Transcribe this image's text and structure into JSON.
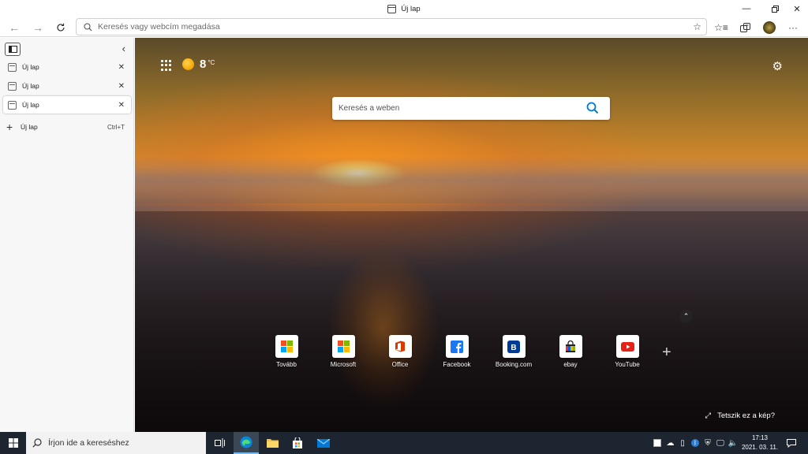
{
  "window": {
    "title": "Új lap"
  },
  "toolbar": {
    "address_placeholder": "Keresés vagy webcím megadása"
  },
  "vertical_tabs": {
    "tabs": [
      {
        "label": "Új lap",
        "active": false
      },
      {
        "label": "Új lap",
        "active": false
      },
      {
        "label": "Új lap",
        "active": true
      }
    ],
    "new_tab_label": "Új lap",
    "new_tab_shortcut": "Ctrl+T"
  },
  "newtab_page": {
    "weather": {
      "temp": "8",
      "unit": "°C",
      "icon": "sun-icon"
    },
    "search_placeholder": "Keresés a weben",
    "quick_links": [
      {
        "label": "Tovább",
        "icon": "microsoft-logo-icon"
      },
      {
        "label": "Microsoft",
        "icon": "microsoft-logo-icon"
      },
      {
        "label": "Office",
        "icon": "office-icon"
      },
      {
        "label": "Facebook",
        "icon": "facebook-icon"
      },
      {
        "label": "Booking.com",
        "icon": "booking-icon"
      },
      {
        "label": "ebay",
        "icon": "ebay-bag-icon"
      },
      {
        "label": "YouTube",
        "icon": "youtube-icon"
      }
    ],
    "like_image_label": "Tetszik ez a kép?"
  },
  "taskbar": {
    "search_placeholder": "Írjon ide a kereséshez",
    "time": "17:13",
    "date": "2021. 03. 11."
  },
  "colors": {
    "taskbar_bg": "#1c2530",
    "accent": "#0078d4",
    "facebook": "#1877f2",
    "booking": "#003b95",
    "youtube": "#e62117",
    "office": "#d83b01"
  }
}
